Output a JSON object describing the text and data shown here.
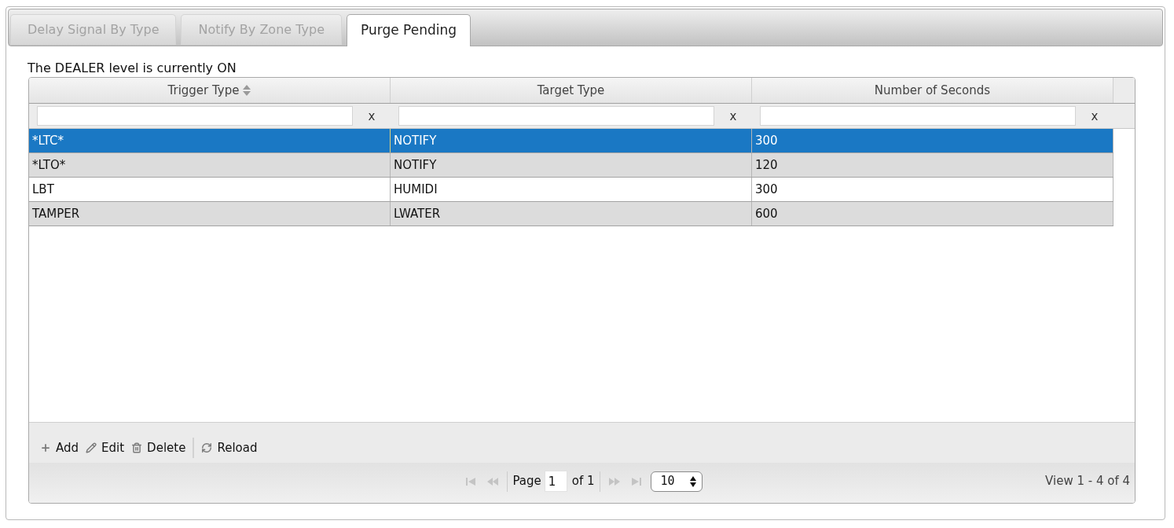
{
  "tabs": [
    {
      "label": "Delay Signal By Type",
      "selected": false
    },
    {
      "label": "Notify By Zone Type",
      "selected": false
    },
    {
      "label": "Purge Pending",
      "selected": true
    }
  ],
  "status_message": "The DEALER level is currently ON",
  "grid": {
    "columns": [
      {
        "label": "Trigger Type",
        "sort_icon": true
      },
      {
        "label": "Target Type",
        "sort_icon": false
      },
      {
        "label": "Number of Seconds",
        "sort_icon": false
      }
    ],
    "filters": [
      {
        "clear": "x"
      },
      {
        "clear": "x"
      },
      {
        "clear": "x"
      }
    ],
    "rows": [
      {
        "cells": [
          "*LTC*",
          "NOTIFY",
          "300"
        ],
        "selected": true
      },
      {
        "cells": [
          "*LTO*",
          "NOTIFY",
          "120"
        ],
        "selected": false
      },
      {
        "cells": [
          "LBT",
          "HUMIDI",
          "300"
        ],
        "selected": false
      },
      {
        "cells": [
          "TAMPER",
          "LWATER",
          "600"
        ],
        "selected": false
      }
    ]
  },
  "toolbar": [
    {
      "kind": "add",
      "label": "Add"
    },
    {
      "kind": "edit",
      "label": "Edit"
    },
    {
      "kind": "delete",
      "label": "Delete"
    },
    {
      "kind": "separator"
    },
    {
      "kind": "reload",
      "label": "Reload"
    }
  ],
  "pager": {
    "nav_before": [
      {
        "kind": "first",
        "disabled": true
      },
      {
        "kind": "prev",
        "disabled": true
      }
    ],
    "page_label": "Page",
    "page_value": "1",
    "of_label": "of 1",
    "nav_after": [
      {
        "kind": "next",
        "disabled": true
      },
      {
        "kind": "last",
        "disabled": true
      }
    ],
    "page_size": "10",
    "summary": "View 1 - 4 of 4"
  }
}
